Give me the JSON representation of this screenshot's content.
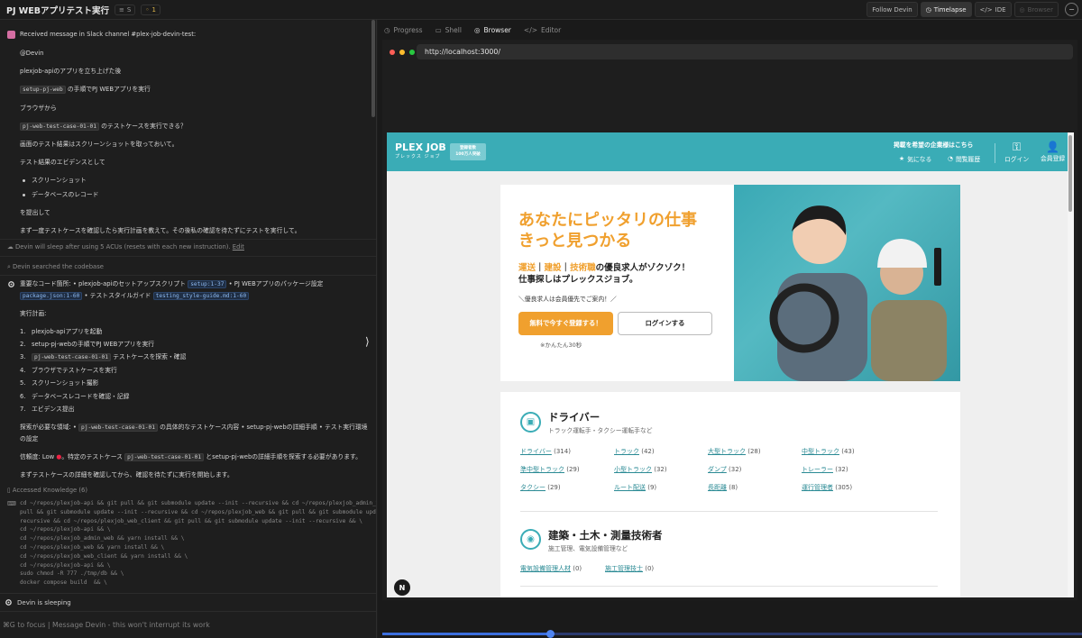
{
  "topbar": {
    "title": "PJ WEBアプリテスト実行",
    "badge_s": "S",
    "badge_count": "1",
    "buttons": {
      "follow": "Follow Devin",
      "timelapse": "Timelapse",
      "ide": "IDE",
      "browser": "Browser"
    }
  },
  "chat": {
    "slack_msg": "Received message in Slack channel #plex-job-devin-test:",
    "lines": [
      "@Devin",
      "plexjob-apiのアプリを立ち上げた後"
    ],
    "code_setup": "setup-pj-web",
    "setup_tail": "の手順でPJ WEBアプリを実行",
    "browser_from": "ブラウザから",
    "code_case": "pj-web-test-case-01-01",
    "case_tail": "のテストケースを実行できる？",
    "screenshot_req": "画面のテスト結果はスクリーンショットを取っておいて。",
    "evidence": "テスト結果のエビデンスとして",
    "bullets": [
      "スクリーンショット",
      "データベースのレコード"
    ],
    "submit": "を提出して",
    "plan_req": "まず一度テストケースを確認したら実行計画を教えて。その後私の確認を待たずにテストを実行して。",
    "sleep_note": "Devin will sleep after using 5 ACUs (resets with each new instruction).",
    "edit": "Edit",
    "searched": "Devin searched the codebase",
    "key_code_pre": "重要なコード箇所: • plexjob-apiのセットアップスクリプト",
    "tag_setup": "setup:1-37",
    "key_code_mid": "• PJ WEBアプリのパッケージ設定",
    "tag_package": "package.json:1-60",
    "key_code_mid2": "• テストスタイルガイド",
    "tag_style": "testing_style-guide.md:1-60",
    "plan_title": "実行計画:",
    "plan_items": [
      "plexjob-apiアプリを起動",
      "setup-pj-webの手順でPJ WEBアプリを実行",
      "",
      "ブラウザでテストケースを実行",
      "スクリーンショット撮影",
      "データベースレコードを確認・記録",
      "エビデンス提出"
    ],
    "plan3_code": "pj-web-test-case-01-01",
    "plan3_tail": "テストケースを探索・確認",
    "explore_pre": "探索が必要な領域: •",
    "explore_code": "pj-web-test-case-01-01",
    "explore_tail": "の具体的なテストケース内容 • setup-pj-webの詳細手順 • テスト実行環境",
    "explore_tail2": "の設定",
    "conf_pre": "信頼度: Low",
    "conf_mid": "。特定のテストケース",
    "conf_code": "pj-web-test-case-01-01",
    "conf_tail": "とsetup-pj-webの詳細手順を探索する必要があります。",
    "start": "まずテストケースの詳細を確認してから、確認を待たずに実行を開始します。",
    "knowledge": "Accessed Knowledge (6)",
    "cmd": "cd ~/repos/plexjob-api && git pull && git submodule update --init --recursive && cd ~/repos/plexjob_admin_web && git\npull && git submodule update --init --recursive && cd ~/repos/plexjob_web && git pull && git submodule update --init --\nrecursive && cd ~/repos/plexjob_web_client && git pull && git submodule update --init --recursive && \\\ncd ~/repos/plexjob-api && \\\ncd ~/repos/plexjob_admin_web && yarn install && \\\ncd ~/repos/plexjob_web && yarn install && \\\ncd ~/repos/plexjob_web_client && yarn install && \\\ncd ~/repos/plexjob-api && \\\nsudo chmod -R 777 ./tmp/db && \\\ndocker compose build  && \\"
  },
  "status": "Devin is sleeping",
  "input_placeholder": "⌘G to focus | Message Devin - this won't interrupt its work",
  "tabs": [
    "Progress",
    "Shell",
    "Browser",
    "Editor"
  ],
  "url": "http://localhost:3000/",
  "plex": {
    "logo": "PLEX JOB",
    "logo_sub": "プレックス ジョブ",
    "reg_line1": "登録者数",
    "reg_line2": "100万人突破",
    "top_link": "掲載を希望の企業様はこちら",
    "fav": "気になる",
    "history": "閲覧履歴",
    "login": "ログイン",
    "member": "会員登録",
    "hero_title1": "あなたにピッタリの仕事",
    "hero_title2": "きっと見つかる",
    "hero_sub1_a": "運送",
    "hero_sub1_b": "建設",
    "hero_sub1_c": "技術職",
    "hero_sub1_tail": "の優良求人がゾクゾク！",
    "hero_sub2": "仕事探しはプレックスジョブ。",
    "hero_note": "＼優良求人は会員優先でご案内！／",
    "btn_register": "無料で今すぐ登録する！",
    "btn_login": "ログインする",
    "hero_foot": "※かんたん30秒",
    "cat1_name": "ドライバー",
    "cat1_sub": "トラック運転手・タクシー運転手など",
    "cat1_links": [
      [
        "ドライバー",
        "(314)"
      ],
      [
        "トラック",
        "(42)"
      ],
      [
        "大型トラック",
        "(28)"
      ],
      [
        "中型トラック",
        "(43)"
      ],
      [
        "準中型トラック",
        "(29)"
      ],
      [
        "小型トラック",
        "(32)"
      ],
      [
        "ダンプ",
        "(32)"
      ],
      [
        "トレーラー",
        "(32)"
      ],
      [
        "タクシー",
        "(29)"
      ],
      [
        "ルート配送",
        "(9)"
      ],
      [
        "長距離",
        "(8)"
      ],
      [
        "運行管理者",
        "(305)"
      ]
    ],
    "cat2_name": "建築・土木・測量技術者",
    "cat2_sub": "施工管理、電気設備管理など",
    "cat2_links": [
      [
        "電気設備管理人材",
        "(0)"
      ],
      [
        "施工管理技士",
        "(0)"
      ]
    ]
  },
  "timeline_progress": 0.24
}
